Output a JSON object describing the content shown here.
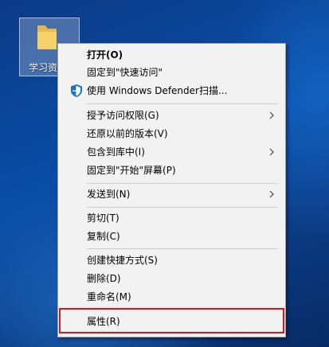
{
  "desktop": {
    "icon_label": "学习资"
  },
  "menu": {
    "items": [
      {
        "label": "打开(O)"
      },
      {
        "label": "固定到\"快速访问\""
      },
      {
        "label": "使用 Windows Defender扫描..."
      },
      {
        "label": "授予访问权限(G)"
      },
      {
        "label": "还原以前的版本(V)"
      },
      {
        "label": "包含到库中(I)"
      },
      {
        "label": "固定到\"开始\"屏幕(P)"
      },
      {
        "label": "发送到(N)"
      },
      {
        "label": "剪切(T)"
      },
      {
        "label": "复制(C)"
      },
      {
        "label": "创建快捷方式(S)"
      },
      {
        "label": "删除(D)"
      },
      {
        "label": "重命名(M)"
      },
      {
        "label": "属性(R)"
      }
    ]
  },
  "colors": {
    "menu_bg": "#f2f2f2",
    "highlight_border": "#d9161c",
    "defender_blue": "#1a73c8"
  }
}
